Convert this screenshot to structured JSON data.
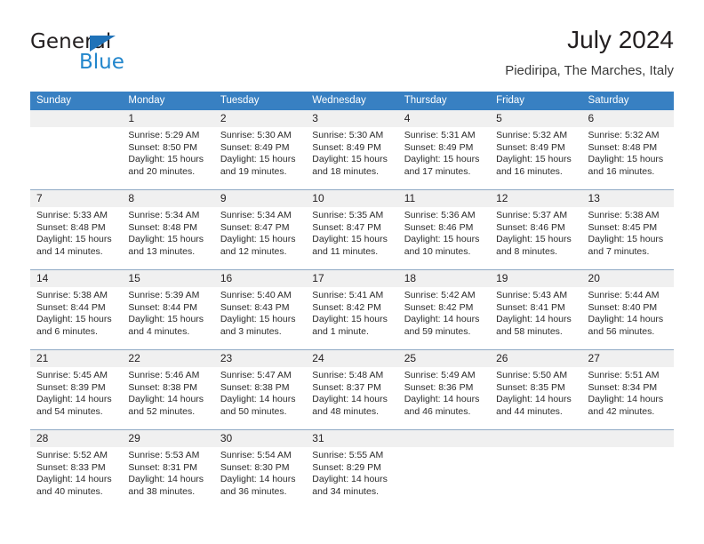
{
  "brand": {
    "name_top": "General",
    "name_bottom": "Blue"
  },
  "header": {
    "title": "July 2024",
    "subtitle": "Piediripa, The Marches, Italy"
  },
  "colors": {
    "header_blue": "#3880c2",
    "band_gray": "#f0f0f0",
    "week_rule": "#8fa9c4",
    "brand_blue": "#2286cc",
    "text": "#231f20"
  },
  "day_names": [
    "Sunday",
    "Monday",
    "Tuesday",
    "Wednesday",
    "Thursday",
    "Friday",
    "Saturday"
  ],
  "weeks": [
    [
      {
        "day": "",
        "sunrise": "",
        "sunset": "",
        "daylight_1": "",
        "daylight_2": ""
      },
      {
        "day": "1",
        "sunrise": "Sunrise: 5:29 AM",
        "sunset": "Sunset: 8:50 PM",
        "daylight_1": "Daylight: 15 hours",
        "daylight_2": "and 20 minutes."
      },
      {
        "day": "2",
        "sunrise": "Sunrise: 5:30 AM",
        "sunset": "Sunset: 8:49 PM",
        "daylight_1": "Daylight: 15 hours",
        "daylight_2": "and 19 minutes."
      },
      {
        "day": "3",
        "sunrise": "Sunrise: 5:30 AM",
        "sunset": "Sunset: 8:49 PM",
        "daylight_1": "Daylight: 15 hours",
        "daylight_2": "and 18 minutes."
      },
      {
        "day": "4",
        "sunrise": "Sunrise: 5:31 AM",
        "sunset": "Sunset: 8:49 PM",
        "daylight_1": "Daylight: 15 hours",
        "daylight_2": "and 17 minutes."
      },
      {
        "day": "5",
        "sunrise": "Sunrise: 5:32 AM",
        "sunset": "Sunset: 8:49 PM",
        "daylight_1": "Daylight: 15 hours",
        "daylight_2": "and 16 minutes."
      },
      {
        "day": "6",
        "sunrise": "Sunrise: 5:32 AM",
        "sunset": "Sunset: 8:48 PM",
        "daylight_1": "Daylight: 15 hours",
        "daylight_2": "and 16 minutes."
      }
    ],
    [
      {
        "day": "7",
        "sunrise": "Sunrise: 5:33 AM",
        "sunset": "Sunset: 8:48 PM",
        "daylight_1": "Daylight: 15 hours",
        "daylight_2": "and 14 minutes."
      },
      {
        "day": "8",
        "sunrise": "Sunrise: 5:34 AM",
        "sunset": "Sunset: 8:48 PM",
        "daylight_1": "Daylight: 15 hours",
        "daylight_2": "and 13 minutes."
      },
      {
        "day": "9",
        "sunrise": "Sunrise: 5:34 AM",
        "sunset": "Sunset: 8:47 PM",
        "daylight_1": "Daylight: 15 hours",
        "daylight_2": "and 12 minutes."
      },
      {
        "day": "10",
        "sunrise": "Sunrise: 5:35 AM",
        "sunset": "Sunset: 8:47 PM",
        "daylight_1": "Daylight: 15 hours",
        "daylight_2": "and 11 minutes."
      },
      {
        "day": "11",
        "sunrise": "Sunrise: 5:36 AM",
        "sunset": "Sunset: 8:46 PM",
        "daylight_1": "Daylight: 15 hours",
        "daylight_2": "and 10 minutes."
      },
      {
        "day": "12",
        "sunrise": "Sunrise: 5:37 AM",
        "sunset": "Sunset: 8:46 PM",
        "daylight_1": "Daylight: 15 hours",
        "daylight_2": "and 8 minutes."
      },
      {
        "day": "13",
        "sunrise": "Sunrise: 5:38 AM",
        "sunset": "Sunset: 8:45 PM",
        "daylight_1": "Daylight: 15 hours",
        "daylight_2": "and 7 minutes."
      }
    ],
    [
      {
        "day": "14",
        "sunrise": "Sunrise: 5:38 AM",
        "sunset": "Sunset: 8:44 PM",
        "daylight_1": "Daylight: 15 hours",
        "daylight_2": "and 6 minutes."
      },
      {
        "day": "15",
        "sunrise": "Sunrise: 5:39 AM",
        "sunset": "Sunset: 8:44 PM",
        "daylight_1": "Daylight: 15 hours",
        "daylight_2": "and 4 minutes."
      },
      {
        "day": "16",
        "sunrise": "Sunrise: 5:40 AM",
        "sunset": "Sunset: 8:43 PM",
        "daylight_1": "Daylight: 15 hours",
        "daylight_2": "and 3 minutes."
      },
      {
        "day": "17",
        "sunrise": "Sunrise: 5:41 AM",
        "sunset": "Sunset: 8:42 PM",
        "daylight_1": "Daylight: 15 hours",
        "daylight_2": "and 1 minute."
      },
      {
        "day": "18",
        "sunrise": "Sunrise: 5:42 AM",
        "sunset": "Sunset: 8:42 PM",
        "daylight_1": "Daylight: 14 hours",
        "daylight_2": "and 59 minutes."
      },
      {
        "day": "19",
        "sunrise": "Sunrise: 5:43 AM",
        "sunset": "Sunset: 8:41 PM",
        "daylight_1": "Daylight: 14 hours",
        "daylight_2": "and 58 minutes."
      },
      {
        "day": "20",
        "sunrise": "Sunrise: 5:44 AM",
        "sunset": "Sunset: 8:40 PM",
        "daylight_1": "Daylight: 14 hours",
        "daylight_2": "and 56 minutes."
      }
    ],
    [
      {
        "day": "21",
        "sunrise": "Sunrise: 5:45 AM",
        "sunset": "Sunset: 8:39 PM",
        "daylight_1": "Daylight: 14 hours",
        "daylight_2": "and 54 minutes."
      },
      {
        "day": "22",
        "sunrise": "Sunrise: 5:46 AM",
        "sunset": "Sunset: 8:38 PM",
        "daylight_1": "Daylight: 14 hours",
        "daylight_2": "and 52 minutes."
      },
      {
        "day": "23",
        "sunrise": "Sunrise: 5:47 AM",
        "sunset": "Sunset: 8:38 PM",
        "daylight_1": "Daylight: 14 hours",
        "daylight_2": "and 50 minutes."
      },
      {
        "day": "24",
        "sunrise": "Sunrise: 5:48 AM",
        "sunset": "Sunset: 8:37 PM",
        "daylight_1": "Daylight: 14 hours",
        "daylight_2": "and 48 minutes."
      },
      {
        "day": "25",
        "sunrise": "Sunrise: 5:49 AM",
        "sunset": "Sunset: 8:36 PM",
        "daylight_1": "Daylight: 14 hours",
        "daylight_2": "and 46 minutes."
      },
      {
        "day": "26",
        "sunrise": "Sunrise: 5:50 AM",
        "sunset": "Sunset: 8:35 PM",
        "daylight_1": "Daylight: 14 hours",
        "daylight_2": "and 44 minutes."
      },
      {
        "day": "27",
        "sunrise": "Sunrise: 5:51 AM",
        "sunset": "Sunset: 8:34 PM",
        "daylight_1": "Daylight: 14 hours",
        "daylight_2": "and 42 minutes."
      }
    ],
    [
      {
        "day": "28",
        "sunrise": "Sunrise: 5:52 AM",
        "sunset": "Sunset: 8:33 PM",
        "daylight_1": "Daylight: 14 hours",
        "daylight_2": "and 40 minutes."
      },
      {
        "day": "29",
        "sunrise": "Sunrise: 5:53 AM",
        "sunset": "Sunset: 8:31 PM",
        "daylight_1": "Daylight: 14 hours",
        "daylight_2": "and 38 minutes."
      },
      {
        "day": "30",
        "sunrise": "Sunrise: 5:54 AM",
        "sunset": "Sunset: 8:30 PM",
        "daylight_1": "Daylight: 14 hours",
        "daylight_2": "and 36 minutes."
      },
      {
        "day": "31",
        "sunrise": "Sunrise: 5:55 AM",
        "sunset": "Sunset: 8:29 PM",
        "daylight_1": "Daylight: 14 hours",
        "daylight_2": "and 34 minutes."
      },
      {
        "day": "",
        "sunrise": "",
        "sunset": "",
        "daylight_1": "",
        "daylight_2": ""
      },
      {
        "day": "",
        "sunrise": "",
        "sunset": "",
        "daylight_1": "",
        "daylight_2": ""
      },
      {
        "day": "",
        "sunrise": "",
        "sunset": "",
        "daylight_1": "",
        "daylight_2": ""
      }
    ]
  ]
}
